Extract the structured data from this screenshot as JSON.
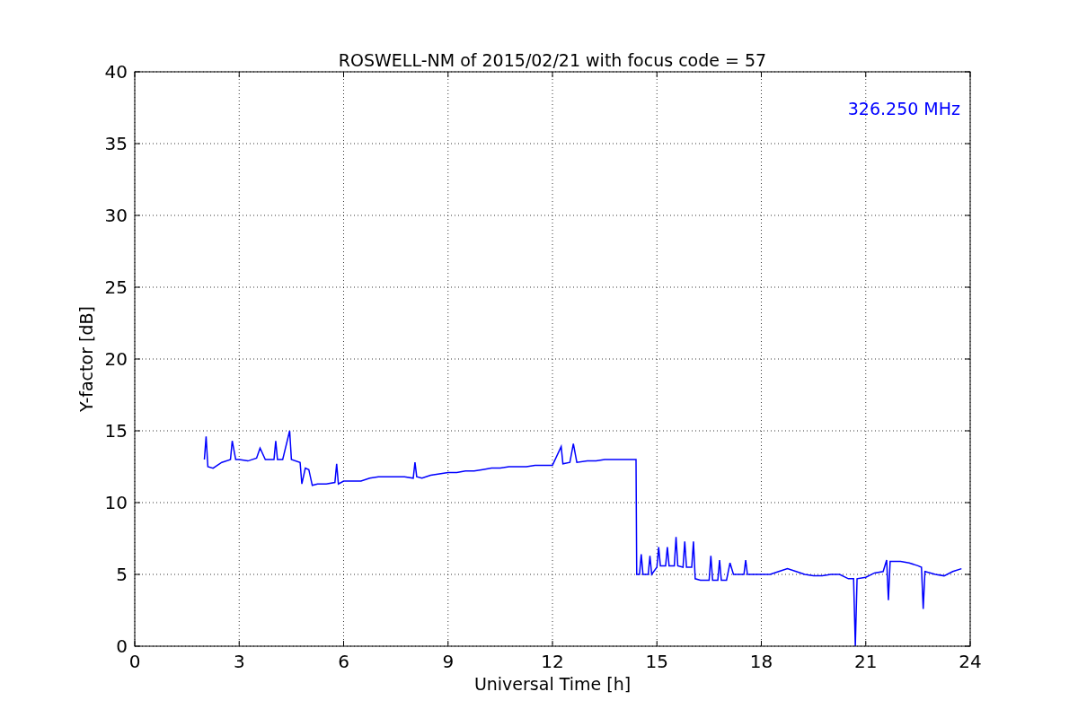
{
  "chart_data": {
    "type": "line",
    "title": "ROSWELL-NM of 2015/02/21 with focus code = 57",
    "xlabel": "Universal Time [h]",
    "ylabel": "Y-factor [dB]",
    "x": [
      2.0,
      2.05,
      2.1,
      2.25,
      2.5,
      2.75,
      2.8,
      2.9,
      3.0,
      3.25,
      3.5,
      3.6,
      3.75,
      4.0,
      4.05,
      4.1,
      4.25,
      4.45,
      4.5,
      4.75,
      4.8,
      4.9,
      5.0,
      5.1,
      5.25,
      5.5,
      5.75,
      5.8,
      5.85,
      6.0,
      6.25,
      6.5,
      6.75,
      7.0,
      7.25,
      7.5,
      7.75,
      8.0,
      8.05,
      8.1,
      8.25,
      8.5,
      8.75,
      9.0,
      9.25,
      9.5,
      9.75,
      10.0,
      10.25,
      10.5,
      10.75,
      11.0,
      11.25,
      11.5,
      11.75,
      12.0,
      12.25,
      12.3,
      12.5,
      12.6,
      12.7,
      13.0,
      13.25,
      13.5,
      13.75,
      14.0,
      14.25,
      14.4,
      14.42,
      14.5,
      14.55,
      14.6,
      14.75,
      14.8,
      14.85,
      15.0,
      15.05,
      15.1,
      15.25,
      15.3,
      15.35,
      15.5,
      15.55,
      15.6,
      15.75,
      15.8,
      15.85,
      16.0,
      16.05,
      16.1,
      16.25,
      16.5,
      16.55,
      16.6,
      16.75,
      16.8,
      16.85,
      17.0,
      17.1,
      17.2,
      17.5,
      17.55,
      17.6,
      18.0,
      18.25,
      18.5,
      18.75,
      19.0,
      19.25,
      19.5,
      19.75,
      20.0,
      20.25,
      20.5,
      20.65,
      20.7,
      20.75,
      21.0,
      21.25,
      21.5,
      21.6,
      21.65,
      21.7,
      22.0,
      22.25,
      22.5,
      22.6,
      22.65,
      22.7,
      23.0,
      23.25,
      23.5,
      23.75
    ],
    "series": [
      {
        "name": "326.250 MHz",
        "color": "#0000ff",
        "values": [
          13.0,
          14.6,
          12.5,
          12.4,
          12.8,
          13.0,
          14.3,
          13.0,
          13.0,
          12.9,
          13.1,
          13.8,
          13.0,
          13.0,
          14.3,
          13.0,
          13.0,
          15.0,
          13.0,
          12.8,
          11.3,
          12.4,
          12.3,
          11.2,
          11.3,
          11.3,
          11.4,
          12.7,
          11.3,
          11.5,
          11.5,
          11.5,
          11.7,
          11.8,
          11.8,
          11.8,
          11.8,
          11.7,
          12.8,
          11.8,
          11.7,
          11.9,
          12.0,
          12.1,
          12.1,
          12.2,
          12.2,
          12.3,
          12.4,
          12.4,
          12.5,
          12.5,
          12.5,
          12.6,
          12.6,
          12.6,
          13.9,
          12.7,
          12.8,
          14.1,
          12.8,
          12.9,
          12.9,
          13.0,
          13.0,
          13.0,
          13.0,
          13.0,
          5.0,
          5.0,
          6.4,
          5.0,
          5.0,
          6.3,
          5.0,
          5.5,
          6.9,
          5.6,
          5.6,
          6.9,
          5.6,
          5.6,
          7.6,
          5.6,
          5.5,
          7.3,
          5.5,
          5.5,
          7.3,
          4.7,
          4.6,
          4.6,
          6.3,
          4.6,
          4.6,
          6.0,
          4.6,
          4.6,
          5.8,
          5.0,
          5.0,
          6.0,
          5.0,
          5.0,
          5.0,
          5.2,
          5.4,
          5.2,
          5.0,
          4.9,
          4.9,
          5.0,
          5.0,
          4.7,
          4.7,
          0.0,
          4.7,
          4.8,
          5.1,
          5.2,
          6.0,
          3.2,
          5.9,
          5.9,
          5.8,
          5.6,
          5.5,
          2.6,
          5.2,
          5.0,
          4.9,
          5.2,
          5.4
        ]
      }
    ],
    "xlim": [
      0,
      24
    ],
    "ylim": [
      0,
      40
    ],
    "xticks": [
      0,
      3,
      6,
      9,
      12,
      15,
      18,
      21,
      24
    ],
    "yticks": [
      0,
      5,
      10,
      15,
      20,
      25,
      30,
      35,
      40
    ],
    "grid": true
  }
}
